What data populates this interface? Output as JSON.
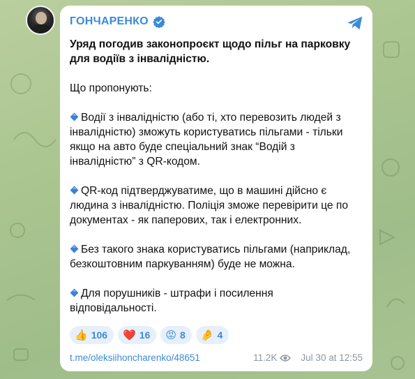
{
  "channel": {
    "name": "ГОНЧАРЕНКО"
  },
  "post": {
    "headline_line1": "Уряд погодив законопроєкт щодо пільг на парковку",
    "headline_line2": "для водіїв з інвалідністю.",
    "intro": "Що пропонують:",
    "points": [
      "Водії з інвалідністю (або ті, хто перевозить людей з інвалідністю) зможуть користуватись пільгами - тільки якщо на авто буде спеціальний знак “Водій з інвалідністю” з QR-кодом.",
      "QR-код підтверджуватиме, що в машині дійсно є людина з інвалідністю. Поліція зможе перевірити це по документах - як паперових, так і електронних.",
      "Без такого знака користуватись пільгами (наприклад, безкоштовним паркуванням) буде не можна.",
      "Для порушників - штрафи і посилення відповідальності."
    ]
  },
  "reactions": [
    {
      "emoji": "👍",
      "icon": "thumbs-up-icon",
      "count": "106"
    },
    {
      "emoji": "❤️",
      "icon": "heart-icon",
      "count": "16"
    },
    {
      "emoji": "😡",
      "icon": "angry-face-icon",
      "count": "8"
    },
    {
      "emoji": "🤌",
      "icon": "pinched-fingers-icon",
      "count": "4"
    }
  ],
  "footer": {
    "link": "t.me/oleksiihoncharenko/48651",
    "views": "11.2K",
    "date": "Jul 30 at 12:55"
  },
  "colors": {
    "accent": "#3a8bd6",
    "bullet_diamond": "#3b82d6",
    "reaction_bg": "#e7f0fa",
    "meta_gray": "#8c969f"
  }
}
